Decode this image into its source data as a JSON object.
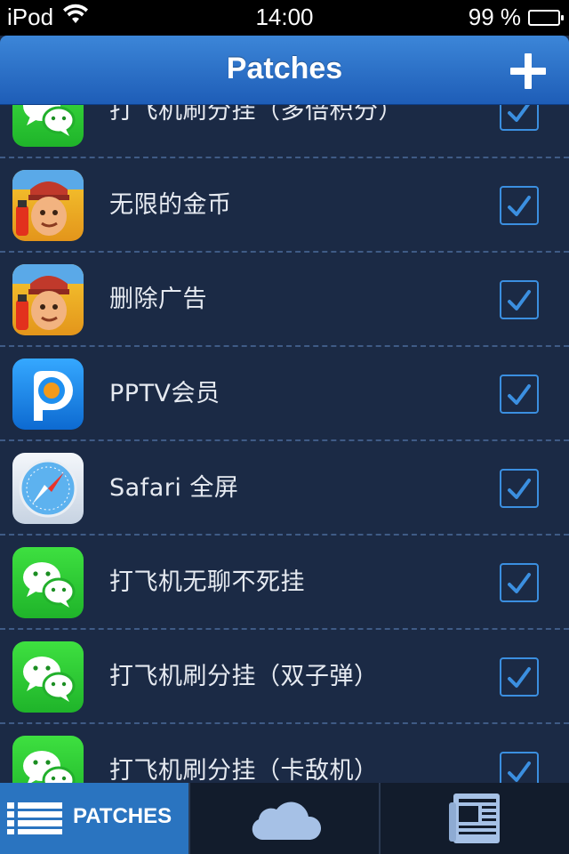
{
  "status_bar": {
    "carrier": "iPod",
    "time": "14:00",
    "battery_text": "99 %",
    "icons": [
      "wifi-icon",
      "battery-icon"
    ]
  },
  "nav": {
    "title": "Patches",
    "add_icon": "plus-icon"
  },
  "patches": [
    {
      "icon": "wechat-icon",
      "label": "打飞机刷分挂（多倍积分）",
      "checked": true
    },
    {
      "icon": "subway-surfers-icon",
      "label": "无限的金币",
      "checked": true
    },
    {
      "icon": "subway-surfers-icon",
      "label": "删除广告",
      "checked": true
    },
    {
      "icon": "pptv-icon",
      "label": "PPTV会员",
      "checked": true
    },
    {
      "icon": "safari-icon",
      "label": "Safari 全屏",
      "checked": true
    },
    {
      "icon": "wechat-icon",
      "label": "打飞机无聊不死挂",
      "checked": true
    },
    {
      "icon": "wechat-icon",
      "label": "打飞机刷分挂（双子弹）",
      "checked": true
    },
    {
      "icon": "wechat-icon",
      "label": "打飞机刷分挂（卡敌机）",
      "checked": true
    }
  ],
  "tabs": [
    {
      "icon": "list-icon",
      "label": "PATCHES",
      "active": true
    },
    {
      "icon": "cloud-icon",
      "label": "",
      "active": false
    },
    {
      "icon": "newspaper-icon",
      "label": "",
      "active": false
    }
  ],
  "colors": {
    "background": "#1b2a45",
    "accent": "#2a74c0",
    "check": "#3b8fe0"
  }
}
